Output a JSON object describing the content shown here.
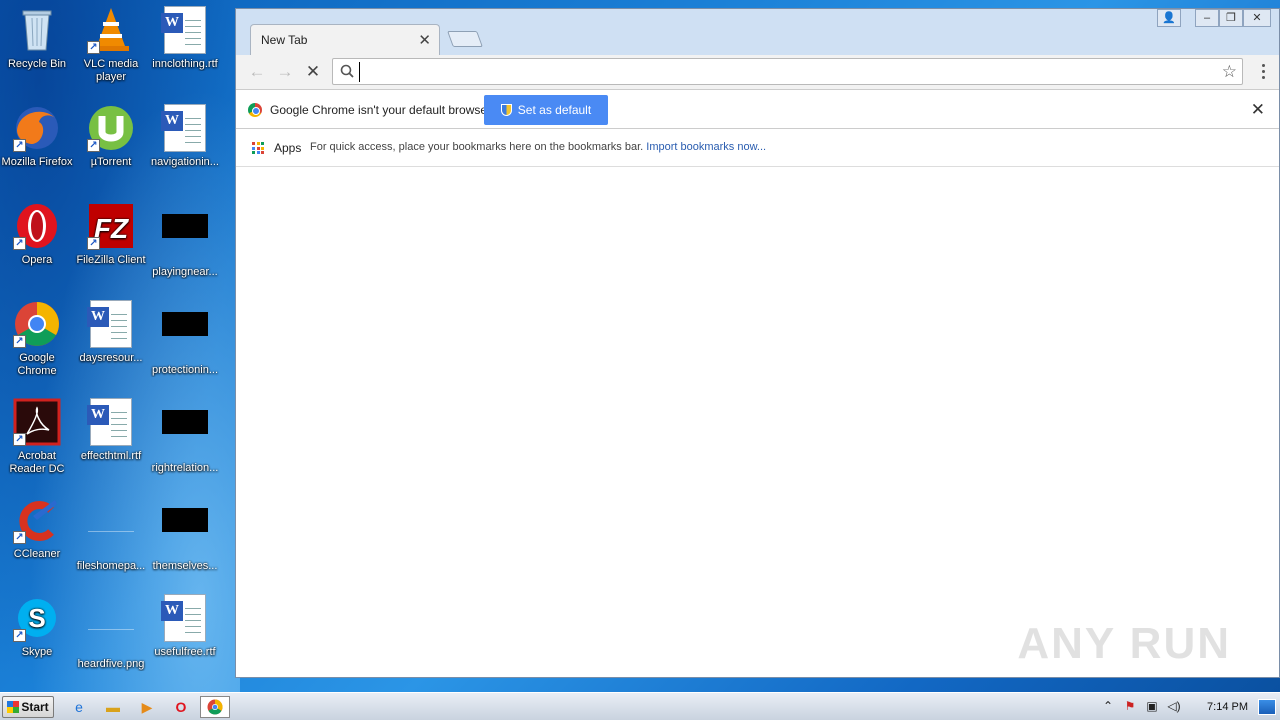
{
  "desktop": {
    "icons": [
      {
        "label": "Recycle Bin"
      },
      {
        "label": "VLC media player"
      },
      {
        "label": "innclothing.rtf"
      },
      {
        "label": "Mozilla Firefox"
      },
      {
        "label": "µTorrent"
      },
      {
        "label": "navigationin..."
      },
      {
        "label": "Opera"
      },
      {
        "label": "FileZilla Client"
      },
      {
        "label": "playingnear..."
      },
      {
        "label": "Google Chrome"
      },
      {
        "label": "daysresour..."
      },
      {
        "label": "protectionin..."
      },
      {
        "label": "Acrobat Reader DC"
      },
      {
        "label": "effecthtml.rtf"
      },
      {
        "label": "rightrelation..."
      },
      {
        "label": "CCleaner"
      },
      {
        "label": "fileshomepa..."
      },
      {
        "label": "themselves..."
      },
      {
        "label": "Skype"
      },
      {
        "label": "heardfive.png"
      },
      {
        "label": "usefulfree.rtf"
      }
    ]
  },
  "browser": {
    "tab_title": "New Tab",
    "address_value": "",
    "infobar": {
      "message": "Google Chrome isn't your default browser.",
      "button": "Set as default"
    },
    "bookmarks": {
      "apps_label": "Apps",
      "hint": "For quick access, place your bookmarks here on the bookmarks bar.",
      "import_link": "Import bookmarks now..."
    },
    "watermark": "ANY RUN"
  },
  "taskbar": {
    "start_label": "Start",
    "clock": "7:14 PM"
  },
  "colors": {
    "accent": "#4a8af4",
    "link": "#2a5db0"
  }
}
